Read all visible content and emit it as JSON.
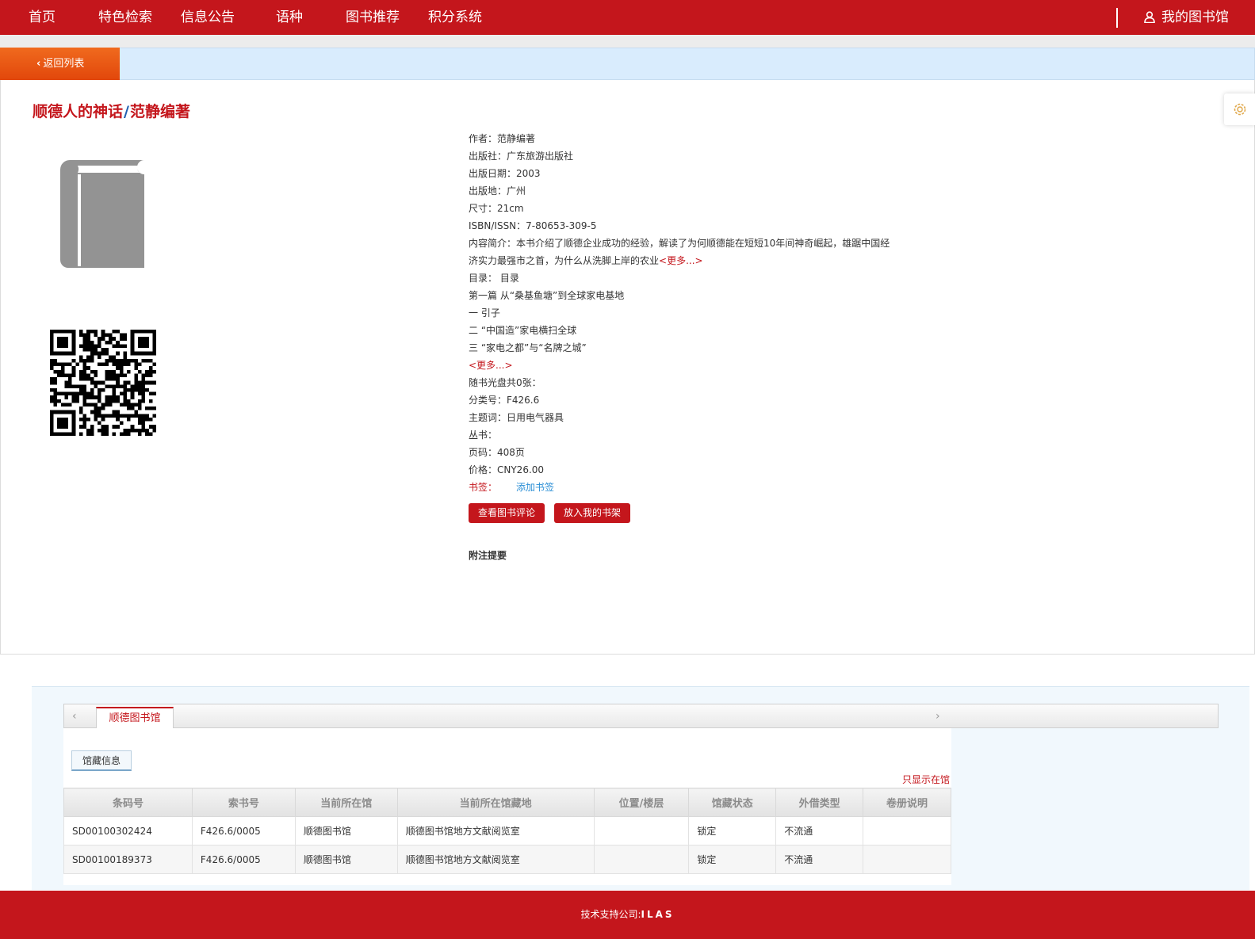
{
  "nav": {
    "items": [
      "首页",
      "特色检索",
      "信息公告",
      "语种",
      "图书推荐",
      "积分系统"
    ],
    "my_library": "我的图书馆"
  },
  "back_button": "返回列表",
  "book": {
    "title": "顺德人的神话",
    "slash": "/",
    "responsibility": "范静编著"
  },
  "info_rows": [
    "作者：范静编著",
    "出版社：广东旅游出版社",
    "出版日期：2003",
    "出版地：广州",
    "尺寸：21cm",
    "ISBN/ISSN：7-80653-309-5",
    "内容简介：本书介绍了顺德企业成功的经验，解读了为何顺德能在短短10年间神奇崛起，雄踞中国经",
    "济实力最强市之首，为什么从洗脚上岸的农业",
    "目录： 目录",
    "第一篇 从“桑基鱼塘”到全球家电基地",
    "一 引子",
    "二 “中国造”家电横扫全球",
    "三 “家电之都”与“名牌之城”",
    "",
    "随书光盘共0张：",
    "分类号：F426.6",
    "主题词：日用电气器具",
    "丛书：",
    "页码：408页",
    "价格：CNY26.00"
  ],
  "more_link": "<更多...>",
  "bookmark_label": "书签：",
  "add_bookmark": "添加书签",
  "buttons": {
    "view_reviews": "查看图书评论",
    "add_to_shelf": "放入我的书架"
  },
  "notes_heading": "附注提要",
  "holdings": {
    "library_tab": "顺德图书馆",
    "sub_tab": "馆藏信息",
    "only_show": "只显示在馆",
    "columns": [
      "条码号",
      "索书号",
      "当前所在馆",
      "当前所在馆藏地",
      "位置/楼层",
      "馆藏状态",
      "外借类型",
      "卷册说明"
    ],
    "rows": [
      [
        "SD00100302424",
        "F426.6/0005",
        "顺德图书馆",
        "顺德图书馆地方文献阅览室",
        "",
        "锁定",
        "不流通",
        ""
      ],
      [
        "SD00100189373",
        "F426.6/0005",
        "顺德图书馆",
        "顺德图书馆地方文献阅览室",
        "",
        "锁定",
        "不流通",
        ""
      ]
    ]
  },
  "footer": {
    "label": "技术支持公司:",
    "company": "ILAS"
  },
  "colors": {
    "brand_red": "#c4161c",
    "back_orange": "#ea5a12",
    "link_blue": "#2b8fd6",
    "light_blue_bar": "#d9ecfd"
  },
  "icons": [
    "user-icon",
    "chevron-left-icon",
    "gear-icon",
    "book-cover-icon",
    "qr-code-icon",
    "arrow-left-icon",
    "arrow-right-icon"
  ]
}
